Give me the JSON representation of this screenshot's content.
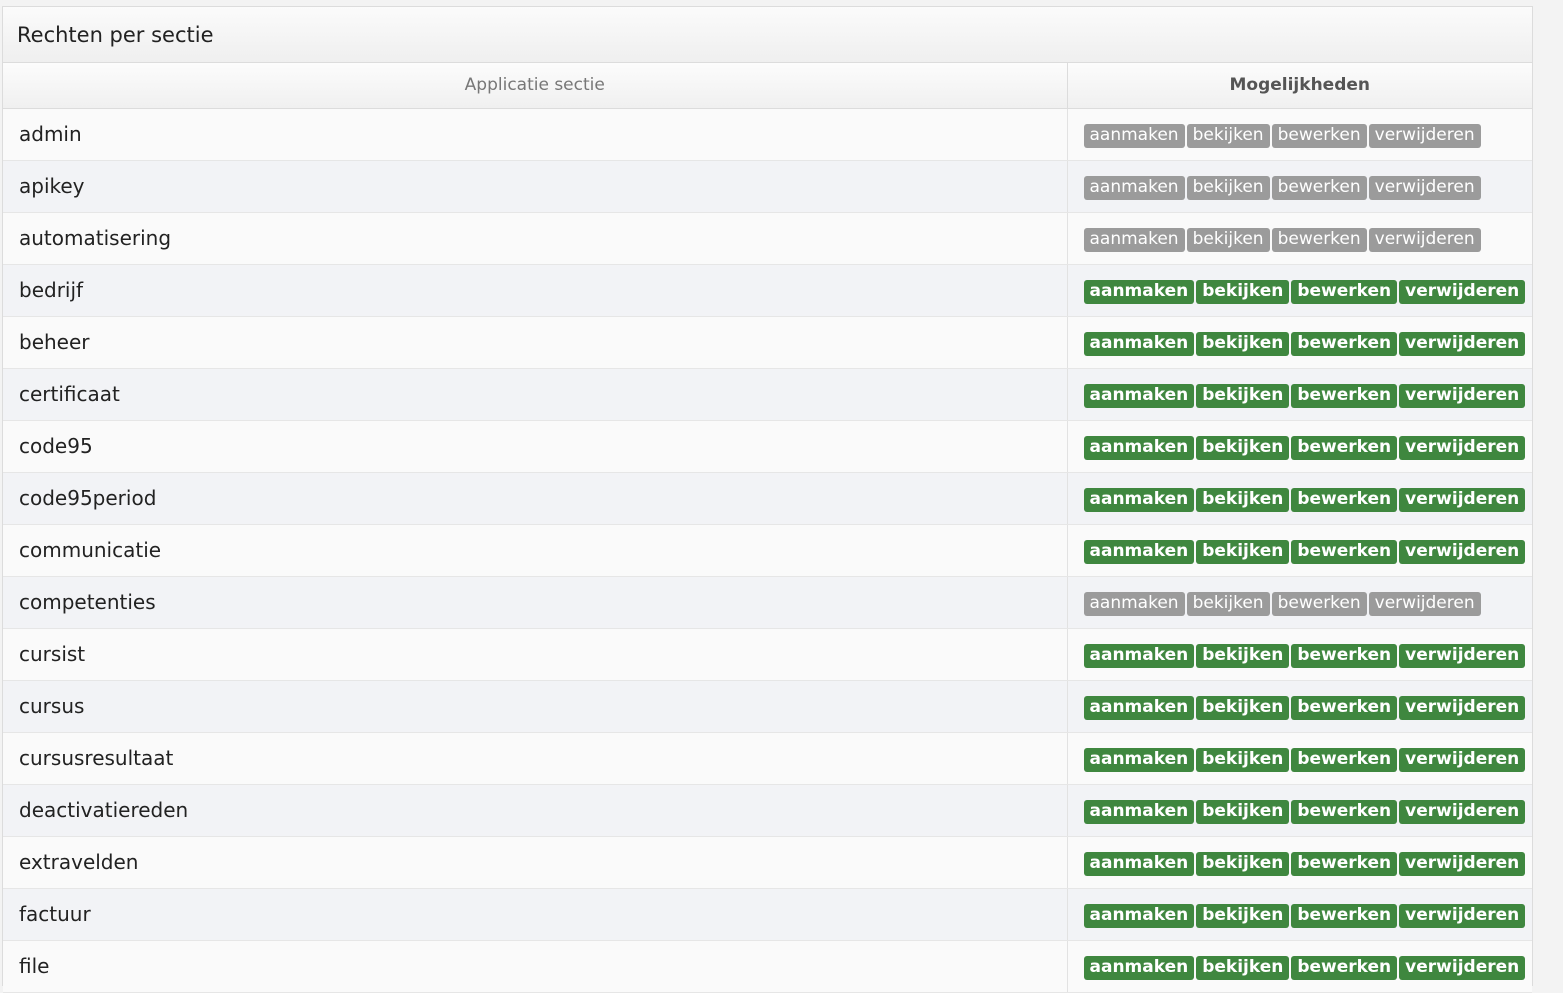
{
  "panel": {
    "title": "Rechten per sectie"
  },
  "table": {
    "headers": {
      "section": "Applicatie sectie",
      "rights": "Mogelijkheden"
    },
    "right_labels": [
      "aanmaken",
      "bekijken",
      "bewerken",
      "verwijderen"
    ],
    "colors": {
      "granted": "#3f873f",
      "denied": "#9b9b9b"
    },
    "rows": [
      {
        "name": "admin",
        "granted": false
      },
      {
        "name": "apikey",
        "granted": false
      },
      {
        "name": "automatisering",
        "granted": false
      },
      {
        "name": "bedrijf",
        "granted": true
      },
      {
        "name": "beheer",
        "granted": true
      },
      {
        "name": "certificaat",
        "granted": true
      },
      {
        "name": "code95",
        "granted": true
      },
      {
        "name": "code95period",
        "granted": true
      },
      {
        "name": "communicatie",
        "granted": true
      },
      {
        "name": "competenties",
        "granted": false
      },
      {
        "name": "cursist",
        "granted": true
      },
      {
        "name": "cursus",
        "granted": true
      },
      {
        "name": "cursusresultaat",
        "granted": true
      },
      {
        "name": "deactivatiereden",
        "granted": true
      },
      {
        "name": "extravelden",
        "granted": true
      },
      {
        "name": "factuur",
        "granted": true
      },
      {
        "name": "file",
        "granted": true
      }
    ]
  }
}
